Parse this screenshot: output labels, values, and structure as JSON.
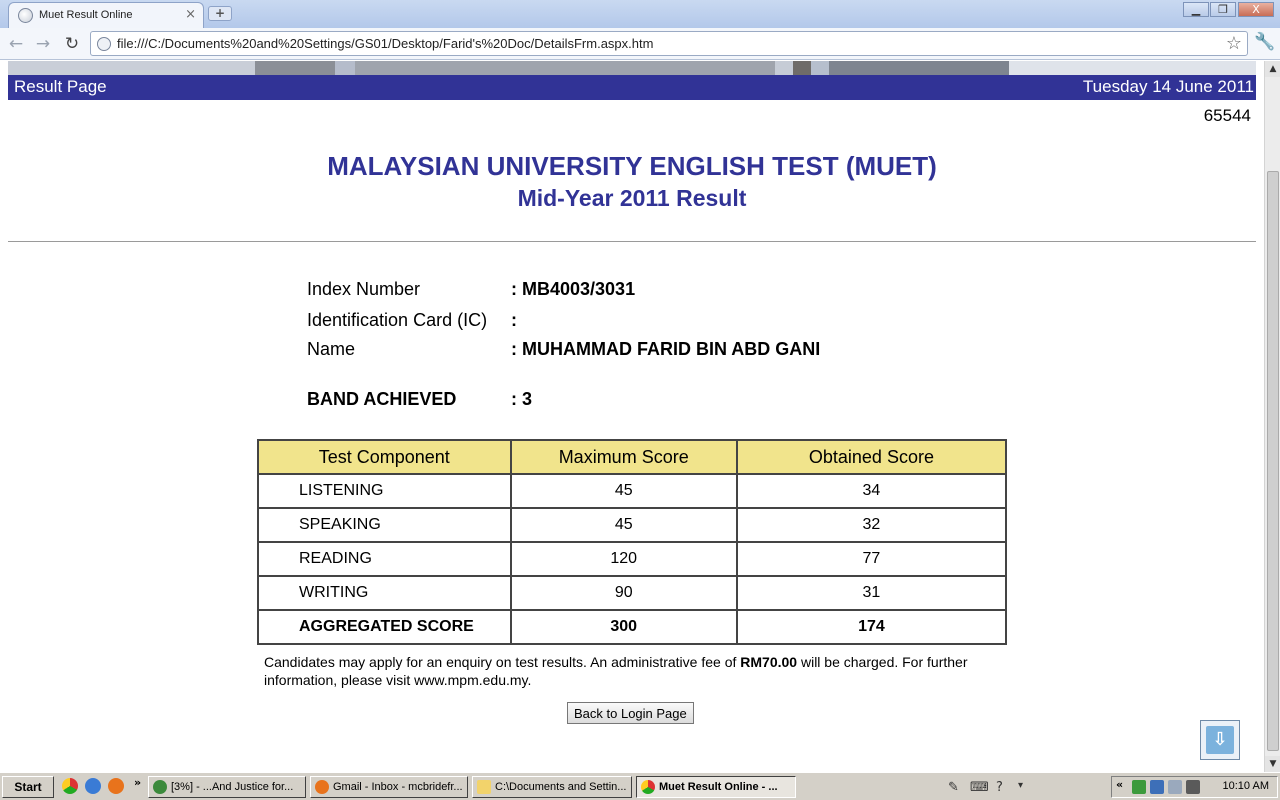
{
  "browser": {
    "tab_title": "Muet Result Online",
    "tab_close": "×",
    "new_tab": "+",
    "url": "file:///C:/Documents%20and%20Settings/GS01/Desktop/Farid's%20Doc/DetailsFrm.aspx.htm",
    "window_minimize": "▁",
    "window_restore": "❐",
    "window_close": "X"
  },
  "header": {
    "left": "Result Page",
    "right": "Tuesday 14 June 2011",
    "counter": "65544"
  },
  "title": {
    "main": "MALAYSIAN UNIVERSITY ENGLISH TEST (MUET)",
    "sub": "Mid-Year 2011 Result"
  },
  "candidate": {
    "index_label": "Index Number",
    "index_value": ": MB4003/3031",
    "ic_label": "Identification Card (IC)",
    "ic_value": ":",
    "name_label": "Name",
    "name_value": ": MUHAMMAD FARID BIN ABD GANI",
    "band_label": "BAND ACHIEVED",
    "band_value": ": 3"
  },
  "scores": {
    "headers": [
      "Test Component",
      "Maximum Score",
      "Obtained Score"
    ],
    "rows": [
      {
        "component": "LISTENING",
        "max": "45",
        "obtained": "34"
      },
      {
        "component": "SPEAKING",
        "max": "45",
        "obtained": "32"
      },
      {
        "component": "READING",
        "max": "120",
        "obtained": "77"
      },
      {
        "component": "WRITING",
        "max": "90",
        "obtained": "31"
      }
    ],
    "total": {
      "component": "AGGREGATED SCORE",
      "max": "300",
      "obtained": "174"
    }
  },
  "notice": {
    "part1": "Candidates may apply for an enquiry on test results. An administrative fee of ",
    "fee": "RM70.00",
    "part2": " will be charged. For further information, please visit www.mpm.edu.my."
  },
  "back_button": "Back to Login Page",
  "taskbar": {
    "start": "Start",
    "more": "»",
    "tasks": [
      {
        "label": "[3%] - ...And Justice for...",
        "active": false
      },
      {
        "label": "Gmail - Inbox - mcbridefr...",
        "active": false
      },
      {
        "label": "C:\\Documents and Settin...",
        "active": false
      },
      {
        "label": "Muet Result Online - ...",
        "active": true
      }
    ],
    "tray_more": "«",
    "clock": "10:10 AM"
  }
}
